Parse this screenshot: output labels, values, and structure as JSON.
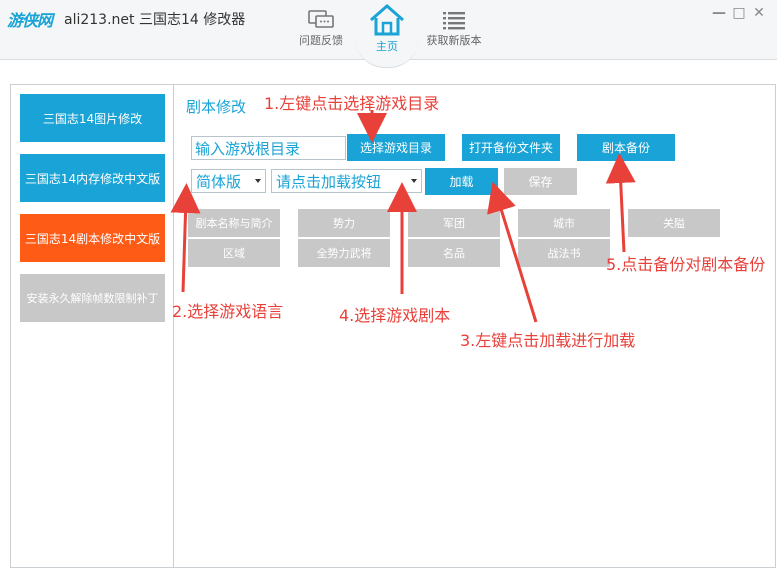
{
  "titlebar": {
    "logo_text": "游侠网",
    "app_title": "ali213.net 三国志14 修改器",
    "nav": {
      "feedback_label": "问题反馈",
      "home_label": "主页",
      "update_label": "获取新版本"
    },
    "window_controls": {
      "minimize": "—",
      "maximize": "□",
      "close": "✕"
    }
  },
  "sidebar": {
    "items": [
      {
        "label": "三国志14图片修改",
        "state": "blue"
      },
      {
        "label": "三国志14内存修改中文版",
        "state": "blue"
      },
      {
        "label": "三国志14剧本修改中文版",
        "state": "active-orange"
      },
      {
        "label": "安装永久解除帧数限制补丁",
        "state": "gray"
      }
    ]
  },
  "content": {
    "section_title": "剧本修改",
    "path_input_value": "输入游戏根目录",
    "select_dir_button": "选择游戏目录",
    "open_backup_button": "打开备份文件夹",
    "backup_button": "剧本备份",
    "language_select_value": "简体版",
    "scenario_select_value": "请点击加载按钮",
    "load_button": "加载",
    "save_button": "保存",
    "tabs": [
      "剧本名称与简介",
      "势力",
      "军团",
      "城市",
      "关隘",
      "区域",
      "全势力武将",
      "名品",
      "战法书"
    ]
  },
  "annotations": {
    "step1": "1.左键点击选择游戏目录",
    "step2": "2.选择游戏语言",
    "step3": "3.左键点击加载进行加载",
    "step4": "4.选择游戏剧本",
    "step5": "5.点击备份对剧本备份"
  },
  "colors": {
    "accent_blue": "#1aa3d6",
    "active_orange": "#fe5b16",
    "disabled_gray": "#c8c8c8",
    "annotation_red": "#e8413a"
  }
}
